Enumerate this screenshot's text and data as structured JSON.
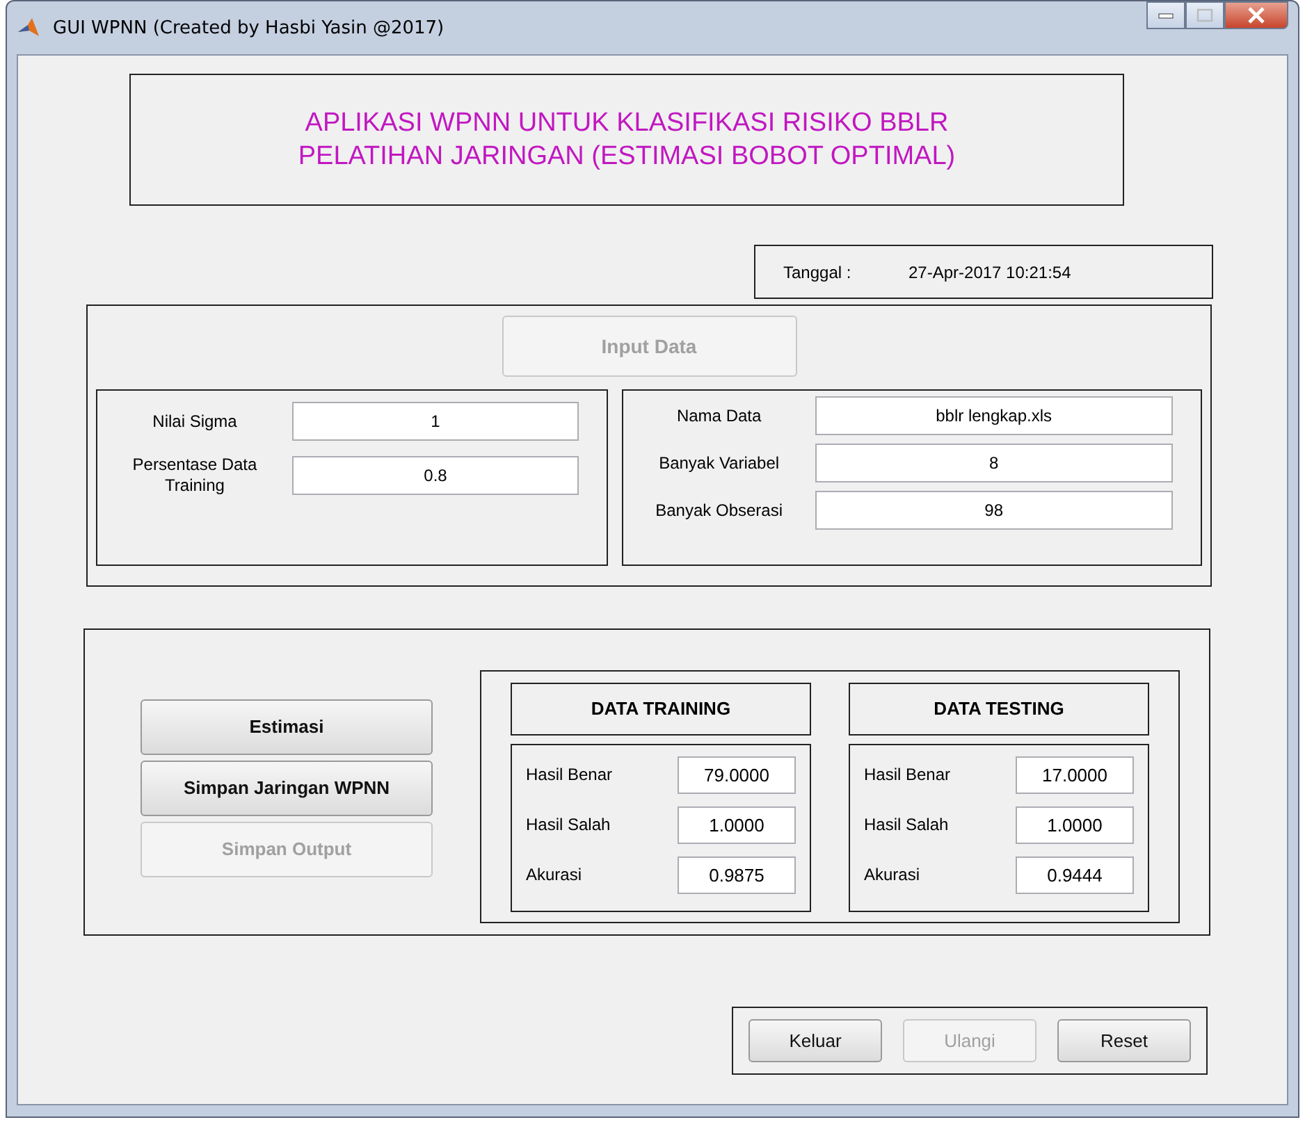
{
  "window": {
    "title": "GUI WPNN (Created by Hasbi Yasin @2017)"
  },
  "header": {
    "lines": [
      "APLIKASI WPNN UNTUK KLASIFIKASI RISIKO BBLR",
      "PELATIHAN JARINGAN (ESTIMASI BOBOT OPTIMAL)"
    ]
  },
  "date": {
    "label": "Tanggal :",
    "value": "27-Apr-2017 10:21:54"
  },
  "input_panel": {
    "button": {
      "label": "Input Data",
      "disabled": true
    },
    "parameters": [
      {
        "label": "Nilai Sigma",
        "value": "1"
      },
      {
        "label": "Persentase Data Training",
        "value": "0.8"
      }
    ],
    "data_info": [
      {
        "label": "Nama Data",
        "value": "bblr lengkap.xls"
      },
      {
        "label": "Banyak Variabel",
        "value": "8"
      },
      {
        "label": "Banyak Obserasi",
        "value": "98"
      }
    ]
  },
  "actions": [
    {
      "label": "Estimasi",
      "disabled": false
    },
    {
      "label": "Simpan Jaringan WPNN",
      "disabled": false
    },
    {
      "label": "Simpan Output",
      "disabled": true
    }
  ],
  "results": [
    {
      "title": "DATA TRAINING",
      "rows": [
        {
          "label": "Hasil Benar",
          "value": "79.0000"
        },
        {
          "label": "Hasil Salah",
          "value": "1.0000"
        },
        {
          "label": "Akurasi",
          "value": "0.9875"
        }
      ]
    },
    {
      "title": "DATA TESTING",
      "rows": [
        {
          "label": "Hasil Benar",
          "value": "17.0000"
        },
        {
          "label": "Hasil Salah",
          "value": "1.0000"
        },
        {
          "label": "Akurasi",
          "value": "0.9444"
        }
      ]
    }
  ],
  "footer_buttons": [
    {
      "label": "Keluar",
      "disabled": false
    },
    {
      "label": "Ulangi",
      "disabled": true
    },
    {
      "label": "Reset",
      "disabled": false
    }
  ]
}
